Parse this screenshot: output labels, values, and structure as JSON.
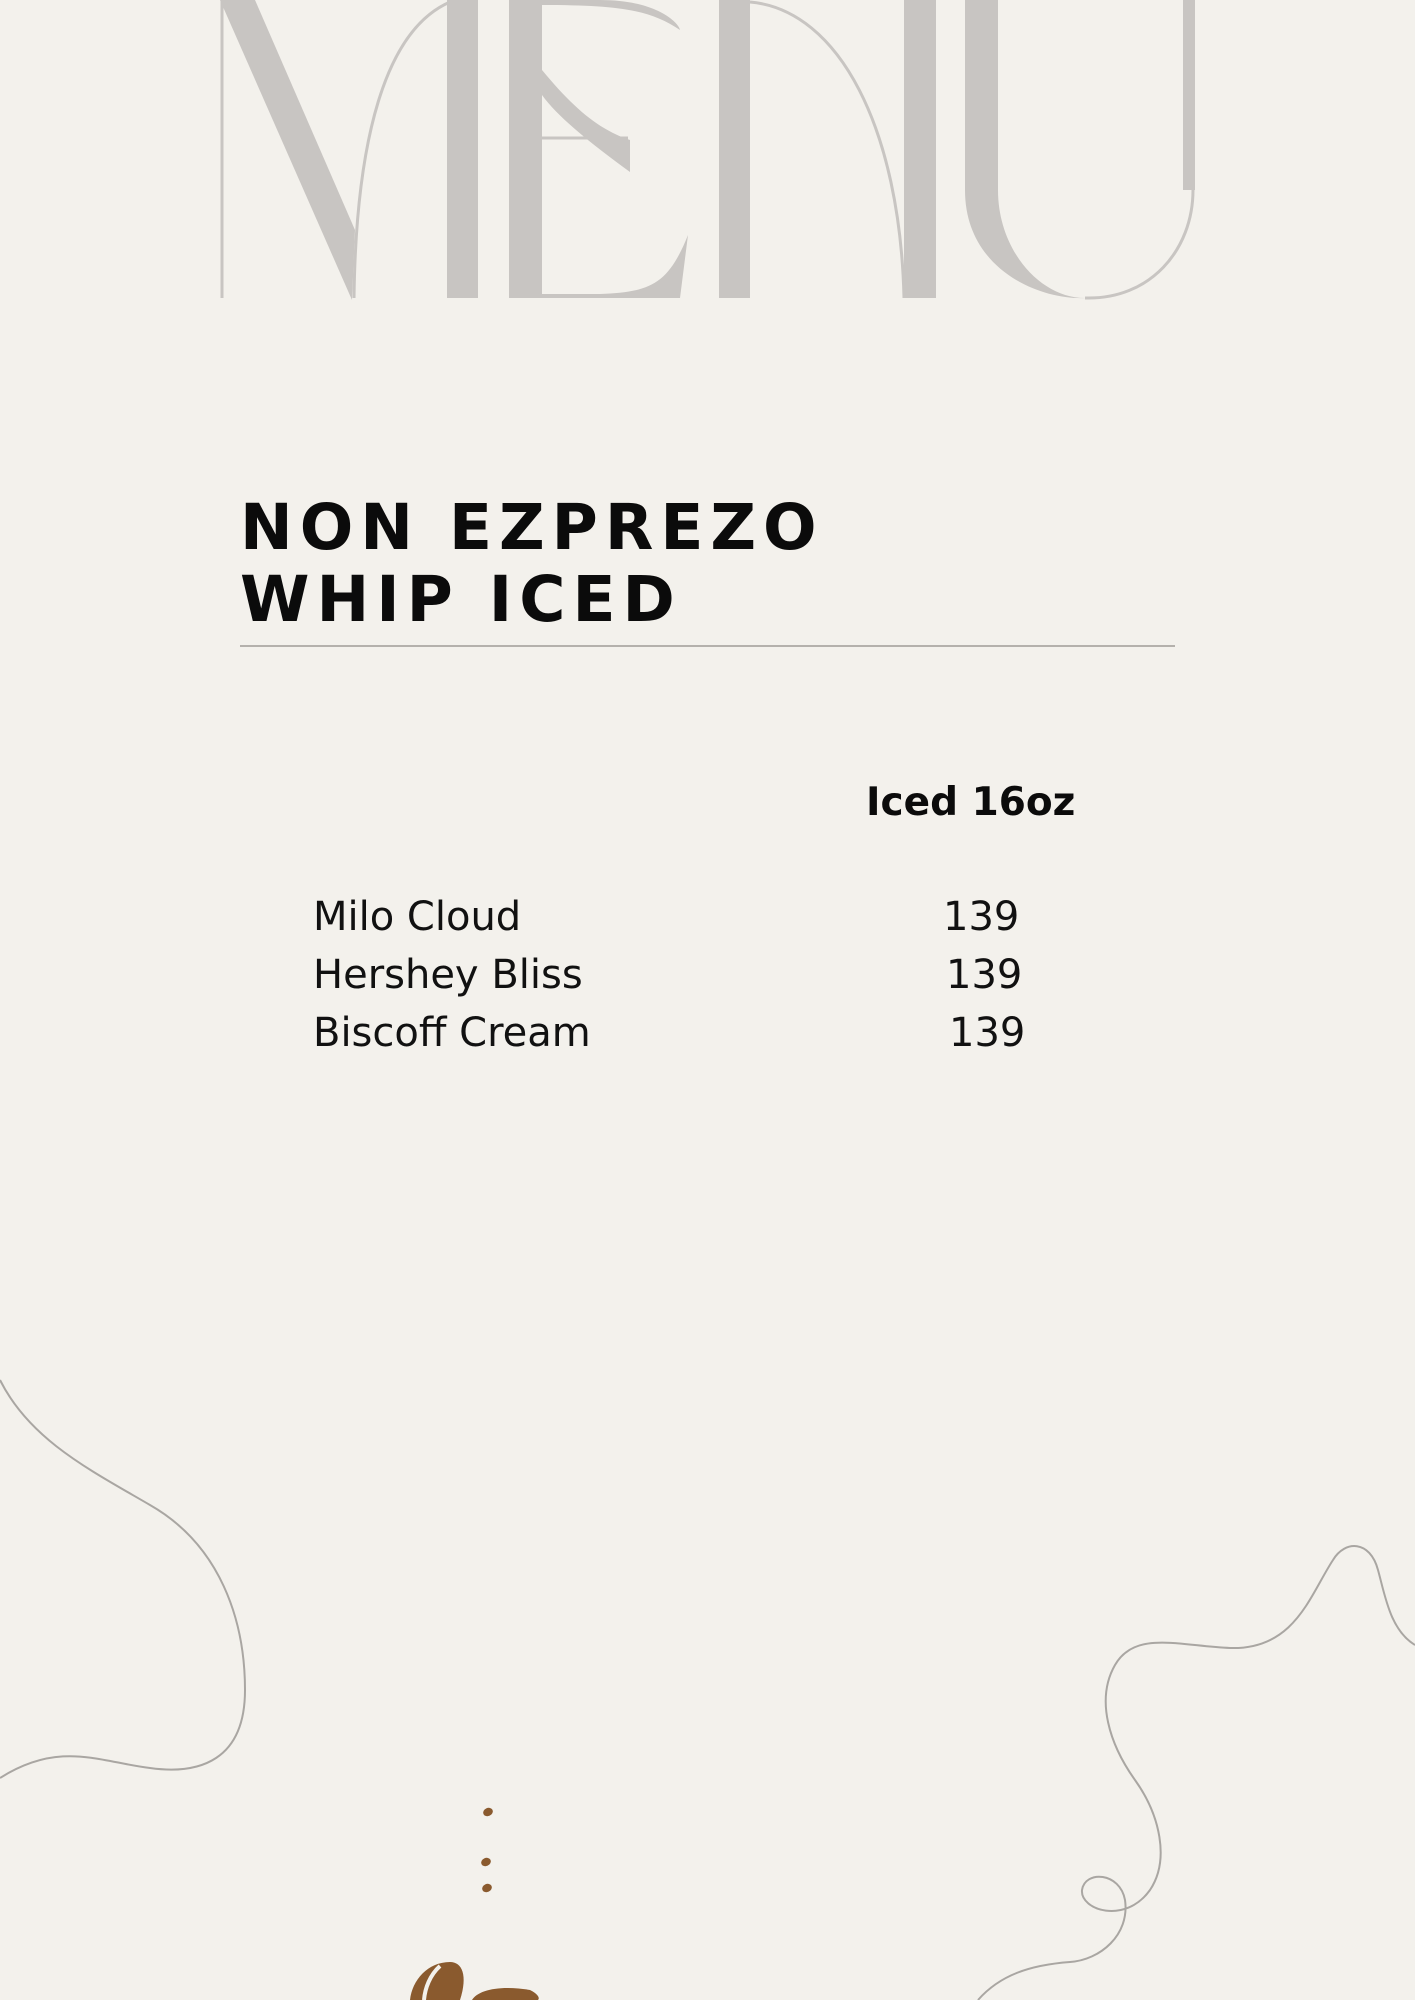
{
  "logo_text": "MENU",
  "section": {
    "title_lines": [
      "NON EZPREZO",
      "WHIP ICED"
    ]
  },
  "size_header": "Iced 16oz",
  "items": [
    {
      "name": "Milo Cloud",
      "price": "139"
    },
    {
      "name": "Hershey Bliss",
      "price": "139"
    },
    {
      "name": "Biscoff Cream",
      "price": "139"
    }
  ],
  "colors": {
    "background": "#f3f1ec",
    "logo": "#c8c5c2",
    "text": "#0b0b0b",
    "accent_brown": "#8a5a2e",
    "line": "#a9a6a2"
  },
  "icons": [
    "coffee-bean-icon",
    "dotted-steam-decoration",
    "squiggle-line-decoration"
  ]
}
